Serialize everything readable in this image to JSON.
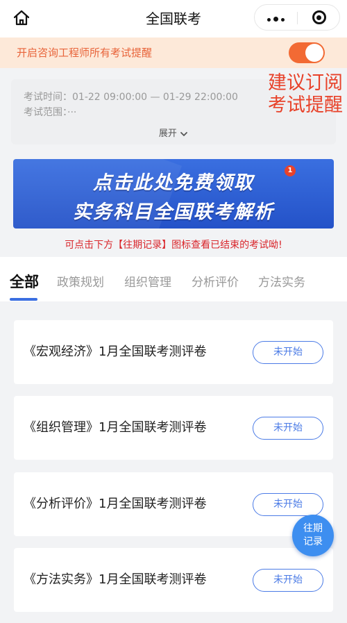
{
  "nav": {
    "title": "全国联考",
    "icons": [
      "home-icon",
      "more-dots-icon",
      "target-close-icon"
    ]
  },
  "reminder": {
    "text": "开启咨询工程师所有考试提醒",
    "toggle_on": true
  },
  "exam_info": {
    "time_line": "考试时间：01-22 09:00:00 — 01-29 22:00:00",
    "scope_line": "考试范围：···",
    "expand_label": "展开"
  },
  "subscribe_hint": {
    "line1": "建议订阅",
    "line2": "考试提醒"
  },
  "banner": {
    "line1": "点击此处免费领取",
    "line2": "实务科目全国联考解析",
    "badge": "1"
  },
  "past_hint": "可点击下方【往期记录】图标查看已结束的考试呦!",
  "tabs": [
    {
      "label": "全部",
      "active": true
    },
    {
      "label": "政策规划",
      "active": false
    },
    {
      "label": "组织管理",
      "active": false
    },
    {
      "label": "分析评价",
      "active": false
    },
    {
      "label": "方法实务",
      "active": false
    }
  ],
  "exams": [
    {
      "title": "《宏观经济》1月全国联考测评卷",
      "status": "未开始"
    },
    {
      "title": "《组织管理》1月全国联考测评卷",
      "status": "未开始"
    },
    {
      "title": "《分析评价》1月全国联考测评卷",
      "status": "未开始"
    },
    {
      "title": "《方法实务》1月全国联考测评卷",
      "status": "未开始"
    }
  ],
  "fab": {
    "line1": "往期",
    "line2": "记录"
  },
  "colors": {
    "accent": "#3b6fe1",
    "toggle": "#f26a34",
    "reminder_bg": "#fde9d9",
    "hint_red": "#d9262b"
  }
}
